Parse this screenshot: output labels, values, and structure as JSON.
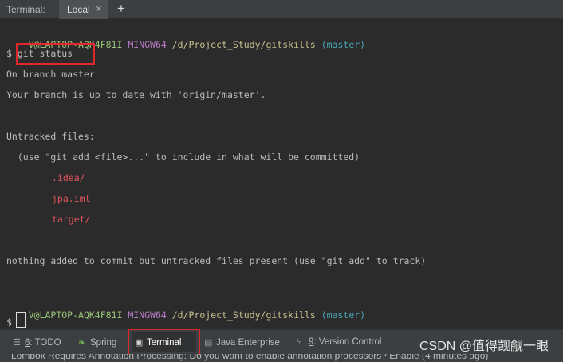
{
  "tabbar": {
    "title": "Terminal:",
    "tab_label": "Local",
    "close": "×",
    "add": "+"
  },
  "terminal": {
    "prompt_user": "V@LAPTOP-AQK4F81I",
    "prompt_shell": "MINGW64",
    "prompt_path": "/d/Project_Study/gitskills",
    "prompt_branch": "(master)",
    "command": "$ git status",
    "out1": "On branch master",
    "out2": "Your branch is up to date with 'origin/master'.",
    "untracked_header": "Untracked files:",
    "untracked_hint": "  (use \"git add <file>...\" to include in what will be committed)",
    "untracked_files": [
      ".idea/",
      "jpa.iml",
      "target/"
    ],
    "summary": "nothing added to commit but untracked files present (use \"git add\" to track)",
    "prompt2_symbol": "$"
  },
  "bottombar": {
    "tabs": [
      {
        "mnemonic": "6",
        "label": ": TODO",
        "icon": "list-icon"
      },
      {
        "label": "Spring",
        "icon": "spring-leaf-icon"
      },
      {
        "label": "Terminal",
        "icon": "terminal-icon"
      },
      {
        "label": "Java Enterprise",
        "icon": "java-ee-icon"
      },
      {
        "mnemonic": "9",
        "label": ": Version Control",
        "icon": "version-control-icon"
      }
    ],
    "watermark": "CSDN @值得觊觎一眼"
  },
  "statusbar": {
    "text": "Lombok Requires Annotation Processing: Do you want to enable annotation processors? Enable (4 minutes ago)"
  },
  "colors": {
    "highlight_box": "#e0282e",
    "background": "#2b2b2b",
    "panel": "#3c3f41"
  }
}
